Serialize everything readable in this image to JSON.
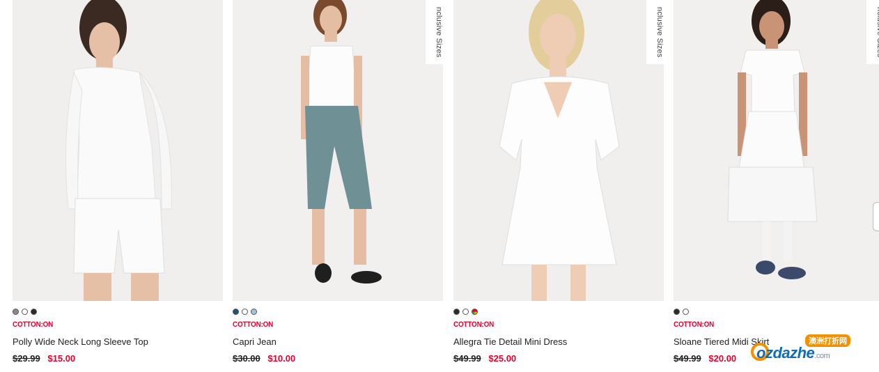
{
  "products": [
    {
      "swatches": [
        "#8a8a8a",
        "#ffffff",
        "#2a2a2a"
      ],
      "brand": "COTTON:ON",
      "name": "Polly Wide Neck Long Sleeve Top",
      "old_price": "$29.99",
      "new_price": "$15.00",
      "tag": ""
    },
    {
      "swatches": [
        "#1f4f7a",
        "#ffffff",
        "#9cc4e4"
      ],
      "brand": "COTTON:ON",
      "name": "Capri Jean",
      "old_price": "$30.00",
      "new_price": "$10.00",
      "tag": "nclusive Sizes"
    },
    {
      "swatches": [
        "#2a2a2a",
        "#ffffff",
        "multicolor"
      ],
      "brand": "COTTON:ON",
      "name": "Allegra Tie Detail Mini Dress",
      "old_price": "$49.99",
      "new_price": "$25.00",
      "tag": "nclusive Sizes"
    },
    {
      "swatches": [
        "#2a2a2a",
        "#ffffff"
      ],
      "brand": "COTTON:ON",
      "name": "Sloane Tiered Midi Skirt",
      "old_price": "$49.99",
      "new_price": "$20.00",
      "tag": "nclusive Sizes"
    }
  ],
  "watermark": {
    "badge": "澳洲打折网",
    "text": "ozdazhe",
    "suffix": ".com"
  },
  "colors": {
    "brand_red": "#e4002b",
    "image_bg": "#f1f1f1"
  }
}
